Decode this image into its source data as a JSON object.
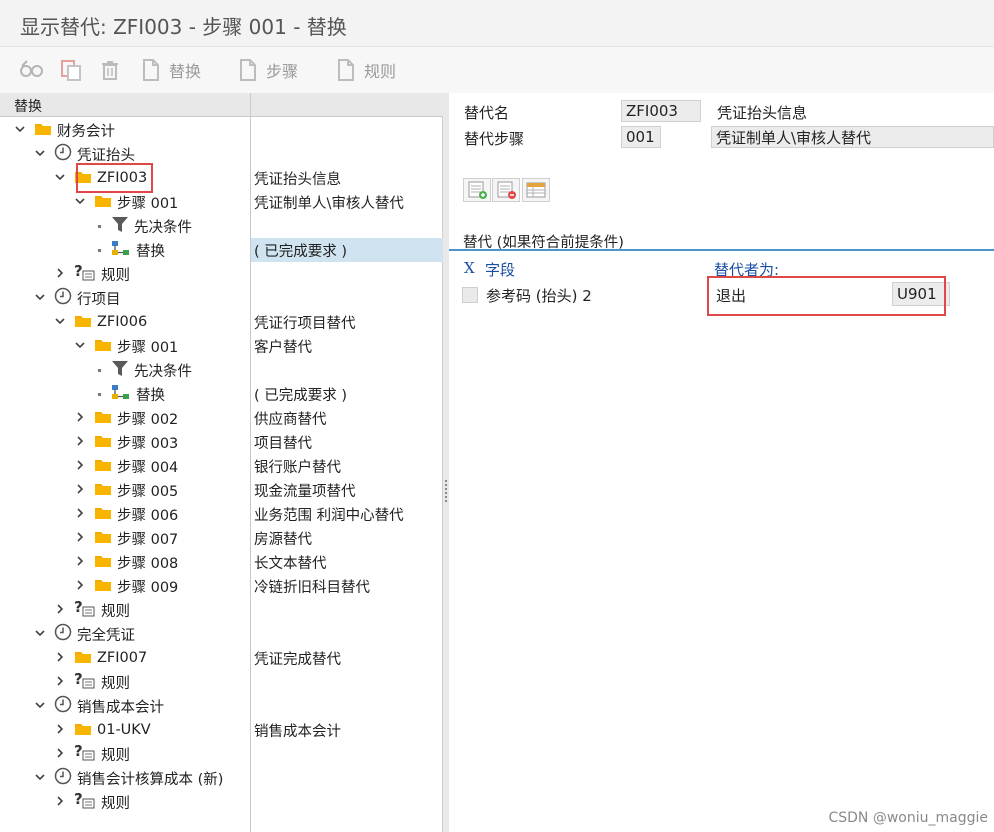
{
  "window": {
    "title": "显示替代: ZFI003 - 步骤 001 - 替换"
  },
  "toolbar": {
    "items": [
      {
        "icon": "glasses-icon",
        "label": ""
      },
      {
        "icon": "copy-icon",
        "label": ""
      },
      {
        "icon": "trash-icon",
        "label": ""
      },
      {
        "icon": "document-icon",
        "label": "替换"
      },
      {
        "icon": "document-icon",
        "label": "步骤"
      },
      {
        "icon": "document-icon",
        "label": "规则"
      }
    ]
  },
  "tree": {
    "header": "替换",
    "rows": [
      {
        "label": "财务会计",
        "desc": ""
      },
      {
        "label": "凭证抬头",
        "desc": ""
      },
      {
        "label": "ZFI003",
        "desc": "凭证抬头信息"
      },
      {
        "label": "步骤 001",
        "desc": "凭证制单人\\审核人替代"
      },
      {
        "label": "先决条件",
        "desc": ""
      },
      {
        "label": "替换",
        "desc": "( 已完成要求 )"
      },
      {
        "label": "规则",
        "desc": ""
      },
      {
        "label": "行项目",
        "desc": ""
      },
      {
        "label": "ZFI006",
        "desc": "凭证行项目替代"
      },
      {
        "label": "步骤 001",
        "desc": "客户替代"
      },
      {
        "label": "先决条件",
        "desc": ""
      },
      {
        "label": "替换",
        "desc": "( 已完成要求 )"
      },
      {
        "label": "步骤 002",
        "desc": "供应商替代"
      },
      {
        "label": "步骤 003",
        "desc": "项目替代"
      },
      {
        "label": "步骤 004",
        "desc": "银行账户替代"
      },
      {
        "label": "步骤 005",
        "desc": "现金流量项替代"
      },
      {
        "label": "步骤 006",
        "desc": "业务范围 利润中心替代"
      },
      {
        "label": "步骤 007",
        "desc": "房源替代"
      },
      {
        "label": "步骤 008",
        "desc": "长文本替代"
      },
      {
        "label": "步骤 009",
        "desc": "冷链折旧科目替代"
      },
      {
        "label": "规则",
        "desc": ""
      },
      {
        "label": "完全凭证",
        "desc": ""
      },
      {
        "label": "ZFI007",
        "desc": "凭证完成替代"
      },
      {
        "label": "规则",
        "desc": ""
      },
      {
        "label": "销售成本会计",
        "desc": ""
      },
      {
        "label": "01-UKV",
        "desc": "销售成本会计"
      },
      {
        "label": "规则",
        "desc": ""
      },
      {
        "label": "销售会计核算成本 (新)",
        "desc": ""
      },
      {
        "label": "规则",
        "desc": ""
      }
    ]
  },
  "detail": {
    "sub_name_label": "替代名",
    "sub_name_value": "ZFI003",
    "sub_name_desc": "凭证抬头信息",
    "step_label": "替代步骤",
    "step_value": "001",
    "step_desc": "凭证制单人\\审核人替代",
    "section_title": "替代 (如果符合前提条件)",
    "field_col_icon": "X",
    "field_col_label": "字段",
    "subst_col_label": "替代者为:",
    "field_name": "参考码 (抬头) 2",
    "subst_text": "退出",
    "subst_value": "U901"
  },
  "footer": {
    "credit": "CSDN @woniu_maggie"
  }
}
